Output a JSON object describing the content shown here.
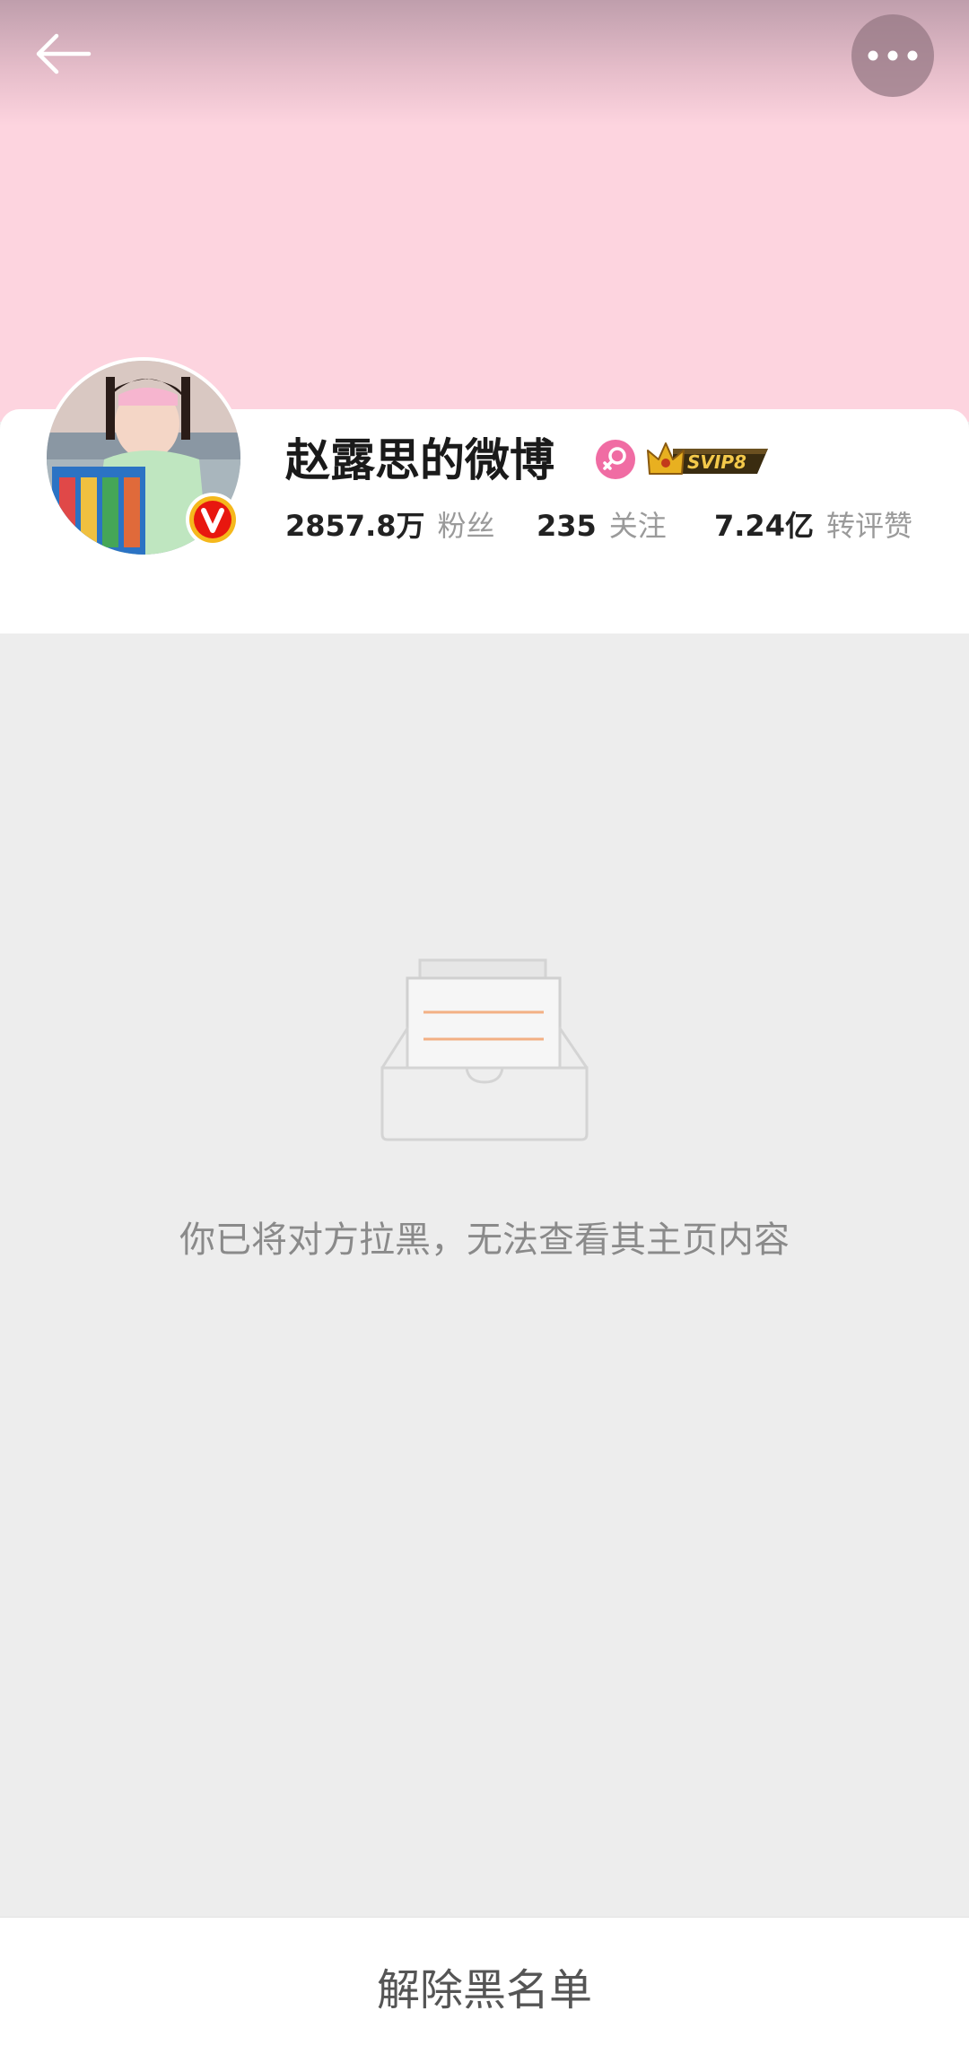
{
  "profile": {
    "name": "赵露思的微博",
    "svip_label": "SVIP8",
    "stats": [
      {
        "value": "2857.8万",
        "label": "粉丝"
      },
      {
        "value": "235",
        "label": "关注"
      },
      {
        "value": "7.24亿",
        "label": "转评赞"
      }
    ]
  },
  "empty_state": {
    "message": "你已将对方拉黑，无法查看其主页内容"
  },
  "bottom_bar": {
    "action_label": "解除黑名单"
  },
  "colors": {
    "banner": "#fdd4df",
    "verified_badge": "#e8170f",
    "svip_gold": "#e8b020",
    "female_badge": "#f06ca3",
    "background": "#ededed"
  },
  "icons": {
    "back": "back-arrow-icon",
    "more": "more-dots-icon",
    "verified": "verified-v-icon",
    "gender": "female-icon",
    "vip": "crown-icon",
    "empty": "empty-box-icon"
  }
}
